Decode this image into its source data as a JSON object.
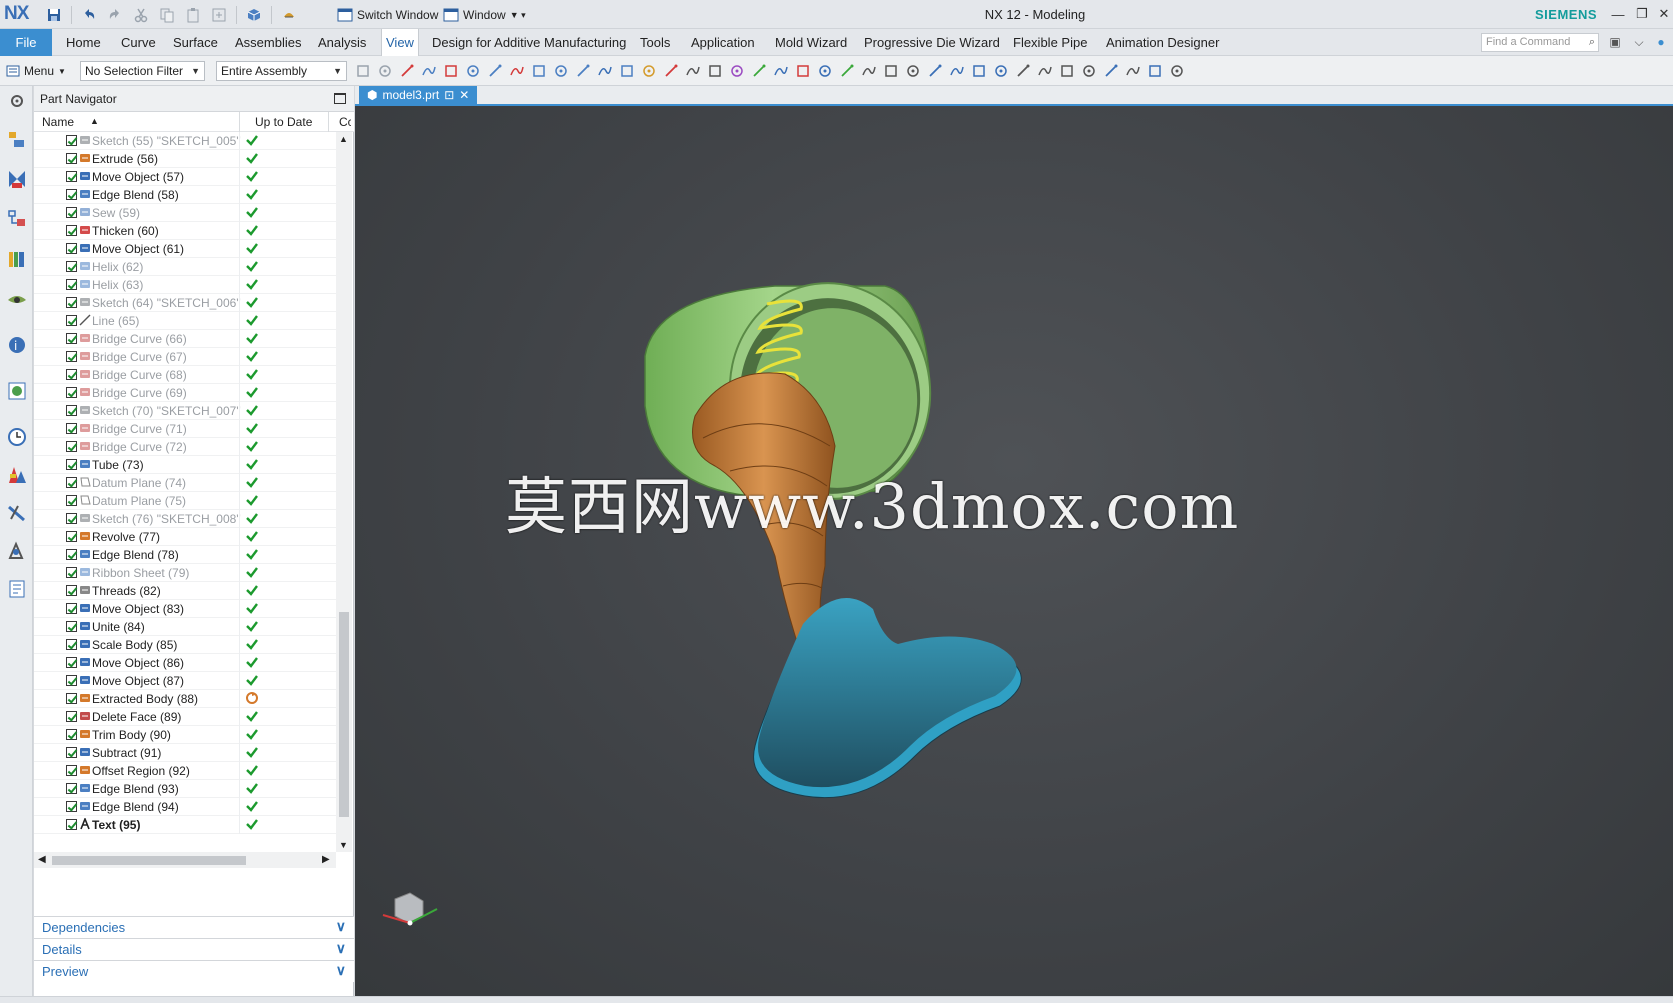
{
  "titlebar": {
    "logo": "NX",
    "app_title": "NX 12 - Modeling",
    "switch_window": "Switch Window",
    "window_menu": "Window",
    "brand": "SIEMENS"
  },
  "tabs": [
    "File",
    "Home",
    "Curve",
    "Surface",
    "Assemblies",
    "Analysis",
    "View",
    "Design for Additive Manufacturing",
    "Tools",
    "Application",
    "Mold Wizard",
    "Progressive Die Wizard",
    "Flexible Pipe",
    "Animation Designer"
  ],
  "active_tab": "View",
  "find_command": {
    "placeholder": "Find a Command"
  },
  "toolbar": {
    "menu_label": "Menu",
    "selection_filter": "No Selection Filter",
    "scope": "Entire Assembly"
  },
  "navigator": {
    "title": "Part Navigator",
    "columns": {
      "name": "Name",
      "up_to_date": "Up to Date",
      "cc": "Cc"
    },
    "rows": [
      {
        "label": "Sketch (55) \"SKETCH_005\"",
        "icon": "sketch-icon",
        "dim": true,
        "status": "ok"
      },
      {
        "label": "Extrude (56)",
        "icon": "extrude-icon",
        "dim": false,
        "status": "ok"
      },
      {
        "label": "Move Object (57)",
        "icon": "move-object-icon",
        "dim": false,
        "status": "ok"
      },
      {
        "label": "Edge Blend (58)",
        "icon": "edge-blend-icon",
        "dim": false,
        "status": "ok"
      },
      {
        "label": "Sew (59)",
        "icon": "sew-icon",
        "dim": true,
        "status": "ok"
      },
      {
        "label": "Thicken (60)",
        "icon": "thicken-icon",
        "dim": false,
        "status": "ok"
      },
      {
        "label": "Move Object (61)",
        "icon": "move-object-icon",
        "dim": false,
        "status": "ok"
      },
      {
        "label": "Helix (62)",
        "icon": "helix-icon",
        "dim": true,
        "status": "ok"
      },
      {
        "label": "Helix (63)",
        "icon": "helix-icon",
        "dim": true,
        "status": "ok"
      },
      {
        "label": "Sketch (64) \"SKETCH_006\"",
        "icon": "sketch-icon",
        "dim": true,
        "status": "ok"
      },
      {
        "label": "Line (65)",
        "icon": "line-icon",
        "dim": true,
        "status": "ok"
      },
      {
        "label": "Bridge Curve (66)",
        "icon": "bridge-curve-icon",
        "dim": true,
        "status": "ok"
      },
      {
        "label": "Bridge Curve (67)",
        "icon": "bridge-curve-icon",
        "dim": true,
        "status": "ok"
      },
      {
        "label": "Bridge Curve (68)",
        "icon": "bridge-curve-icon",
        "dim": true,
        "status": "ok"
      },
      {
        "label": "Bridge Curve (69)",
        "icon": "bridge-curve-icon",
        "dim": true,
        "status": "ok"
      },
      {
        "label": "Sketch (70) \"SKETCH_007\"",
        "icon": "sketch-icon",
        "dim": true,
        "status": "ok"
      },
      {
        "label": "Bridge Curve (71)",
        "icon": "bridge-curve-icon",
        "dim": true,
        "status": "ok"
      },
      {
        "label": "Bridge Curve (72)",
        "icon": "bridge-curve-icon",
        "dim": true,
        "status": "ok"
      },
      {
        "label": "Tube (73)",
        "icon": "tube-icon",
        "dim": false,
        "status": "ok"
      },
      {
        "label": "Datum Plane (74)",
        "icon": "datum-plane-icon",
        "dim": true,
        "status": "ok"
      },
      {
        "label": "Datum Plane (75)",
        "icon": "datum-plane-icon",
        "dim": true,
        "status": "ok"
      },
      {
        "label": "Sketch (76) \"SKETCH_008\"",
        "icon": "sketch-icon",
        "dim": true,
        "status": "ok"
      },
      {
        "label": "Revolve (77)",
        "icon": "revolve-icon",
        "dim": false,
        "status": "ok"
      },
      {
        "label": "Edge Blend (78)",
        "icon": "edge-blend-icon",
        "dim": false,
        "status": "ok"
      },
      {
        "label": "Ribbon Sheet (79)",
        "icon": "ribbon-sheet-icon",
        "dim": true,
        "status": "ok"
      },
      {
        "label": "Threads (82)",
        "icon": "threads-icon",
        "dim": false,
        "status": "ok"
      },
      {
        "label": "Move Object (83)",
        "icon": "move-object-icon",
        "dim": false,
        "status": "ok"
      },
      {
        "label": "Unite (84)",
        "icon": "unite-icon",
        "dim": false,
        "status": "ok"
      },
      {
        "label": "Scale Body (85)",
        "icon": "scale-body-icon",
        "dim": false,
        "status": "ok"
      },
      {
        "label": "Move Object (86)",
        "icon": "move-object-icon",
        "dim": false,
        "status": "ok"
      },
      {
        "label": "Move Object (87)",
        "icon": "move-object-icon",
        "dim": false,
        "status": "ok"
      },
      {
        "label": "Extracted Body (88)",
        "icon": "extracted-body-icon",
        "dim": false,
        "status": "update"
      },
      {
        "label": "Delete Face (89)",
        "icon": "delete-face-icon",
        "dim": false,
        "status": "ok"
      },
      {
        "label": "Trim Body (90)",
        "icon": "trim-body-icon",
        "dim": false,
        "status": "ok"
      },
      {
        "label": "Subtract (91)",
        "icon": "subtract-icon",
        "dim": false,
        "status": "ok"
      },
      {
        "label": "Offset Region (92)",
        "icon": "offset-region-icon",
        "dim": false,
        "status": "ok"
      },
      {
        "label": "Edge Blend (93)",
        "icon": "edge-blend-icon",
        "dim": false,
        "status": "ok"
      },
      {
        "label": "Edge Blend (94)",
        "icon": "edge-blend-icon",
        "dim": false,
        "status": "ok"
      },
      {
        "label": "Text (95)",
        "icon": "text-feature-icon",
        "dim": false,
        "bold": true,
        "status": "ok"
      }
    ],
    "panels": [
      "Dependencies",
      "Details",
      "Preview"
    ]
  },
  "document": {
    "tab_label": "model3.prt"
  },
  "viewport": {
    "watermark": "莫西网www.3dmox.com"
  },
  "colors": {
    "accent": "#3b8ed0",
    "status_ok": "#1c9a2e",
    "cylinder": "#8fc46f",
    "spring": "#e6e03a",
    "horn": "#c57a36",
    "base": "#2b5f74"
  }
}
